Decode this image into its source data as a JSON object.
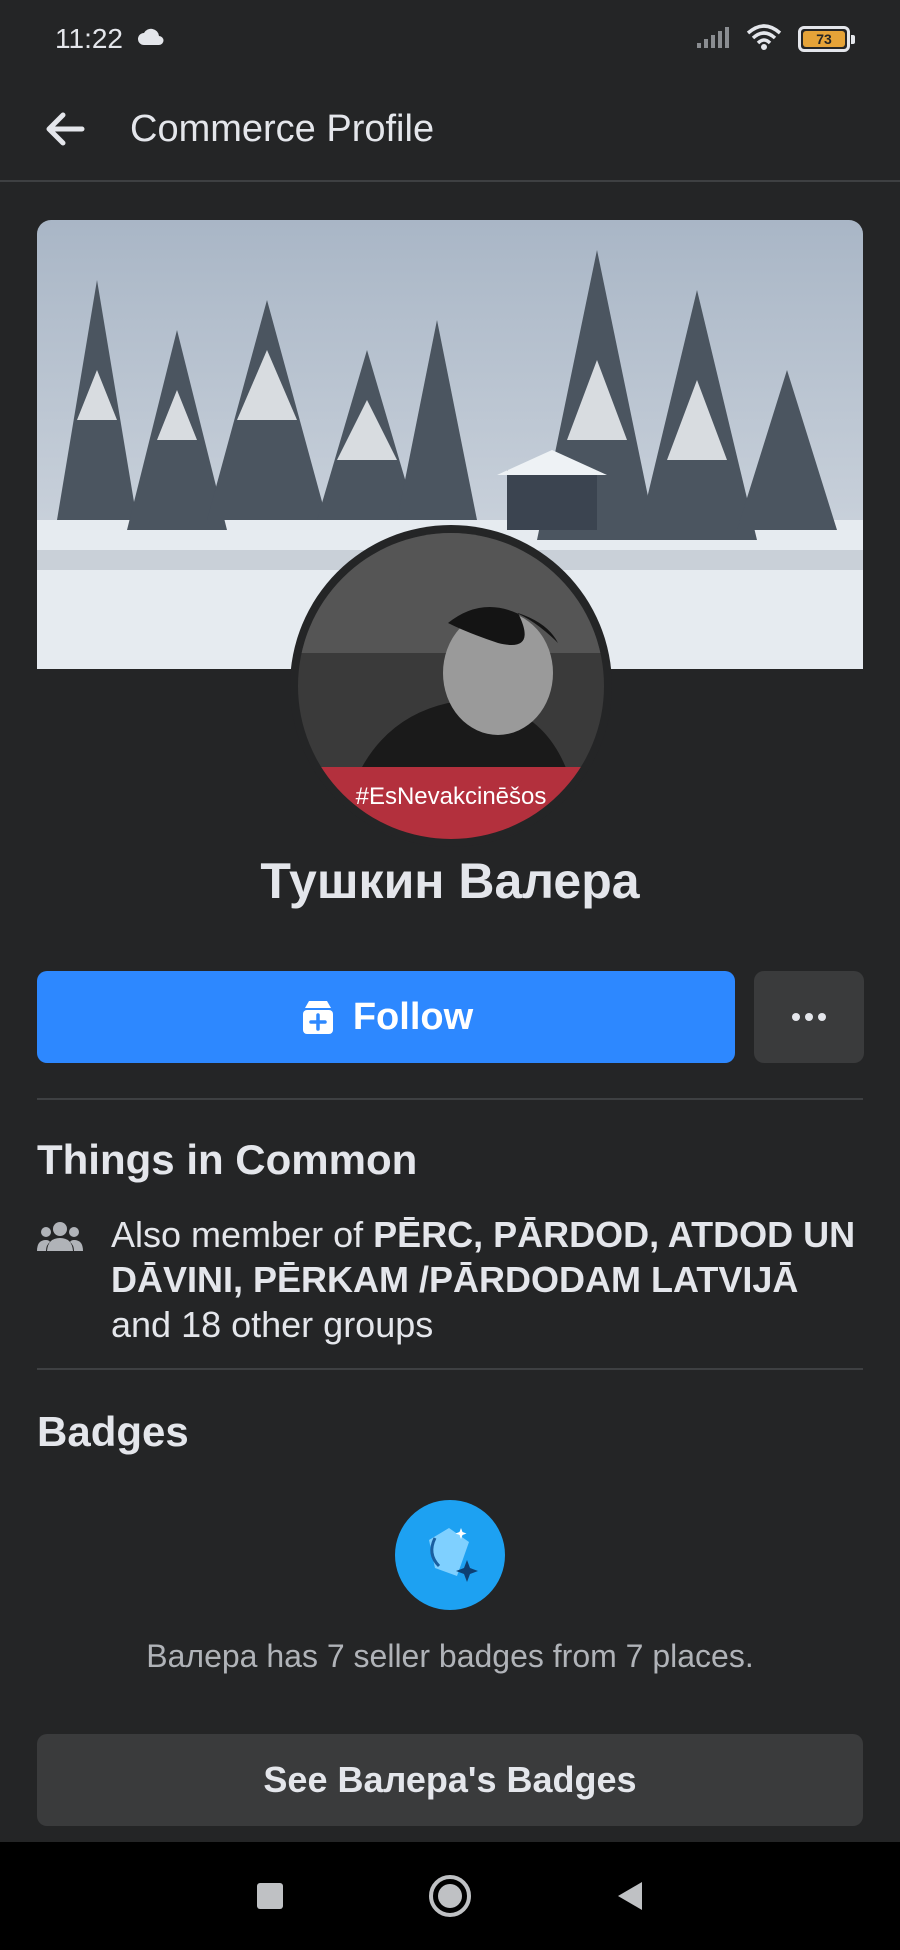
{
  "status_bar": {
    "time": "11:22",
    "battery_level": "73",
    "battery_color": "#e5a338",
    "icons": [
      "cloud-icon",
      "signal-icon",
      "wifi-icon",
      "battery-icon"
    ]
  },
  "header": {
    "title": "Commerce Profile",
    "back_icon": "arrow-left-icon"
  },
  "profile": {
    "name": "Тушкин Валера",
    "avatar_frame_text": "#EsNevakcinēšos",
    "frame_color": "#b3303d"
  },
  "actions": {
    "follow_label": "Follow",
    "follow_color": "#2d88ff",
    "more_icon": "more-dots-icon"
  },
  "things_in_common": {
    "title": "Things in Common",
    "prefix": "Also member of ",
    "groups": "PĒRC, PĀRDOD, ATDOD UN DĀVINI, PĒRKAM /PĀRDODAM LATVIJĀ",
    "suffix": " and 18 other groups",
    "icon": "groups-icon"
  },
  "badges": {
    "title": "Badges",
    "description": "Валера has 7 seller badges from 7 places.",
    "button_label": "See Валера's Badges",
    "icon": "seller-badge-icon"
  },
  "nav": {
    "icons": [
      "recents-icon",
      "home-icon",
      "back-icon"
    ]
  }
}
